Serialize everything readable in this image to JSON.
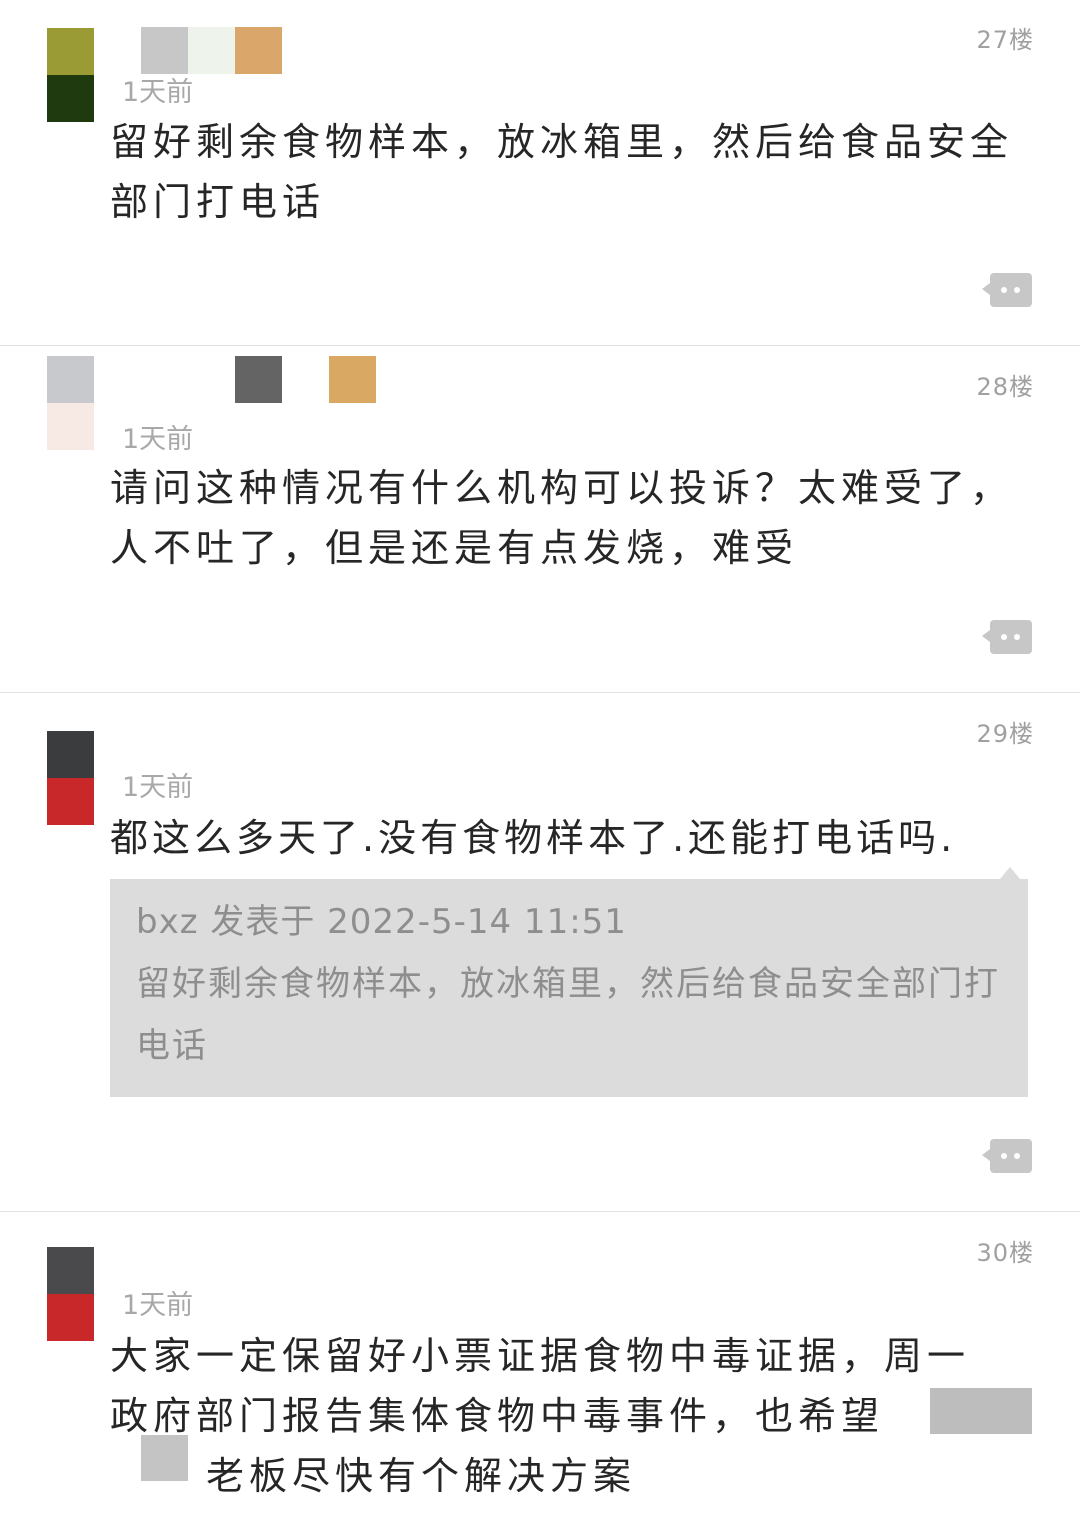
{
  "posts": [
    {
      "floor": "27楼",
      "time": "1天前",
      "content": "留好剩余食物样本，放冰箱里，然后给食品安全部门打电话",
      "avatar_colors": [
        "#9b9b35",
        "#1f3a0e"
      ]
    },
    {
      "floor": "28楼",
      "time": "1天前",
      "content": "请问这种情况有什么机构可以投诉？太难受了，人不吐了，但是还是有点发烧，难受",
      "avatar_colors": [
        "#c8c9cc",
        "#f7e9e4"
      ]
    },
    {
      "floor": "29楼",
      "time": "1天前",
      "content": "都这么多天了.没有食物样本了.还能打电话吗.",
      "avatar_colors": [
        "#3a3c3e",
        "#c9282b"
      ],
      "quote": {
        "header": "bxz 发表于 2022-5-14 11:51",
        "body": "留好剩余食物样本，放冰箱里，然后给食品安全部门打电话"
      }
    },
    {
      "floor": "30楼",
      "time": "1天前",
      "content_line1": "大家一定保留好小票证据食物中毒证据，周一",
      "content_line2": "政府部门报告集体食物中毒事件，也希望",
      "content_line3": "老板尽快有个解决方案",
      "avatar_colors": [
        "#4a4a4c",
        "#c9282b"
      ]
    }
  ],
  "more_icon": "more-dots-icon",
  "colors": {
    "floor_text": "#a0a0a0",
    "quote_bg": "#dcdcdc",
    "divider": "#e3e3e3"
  }
}
